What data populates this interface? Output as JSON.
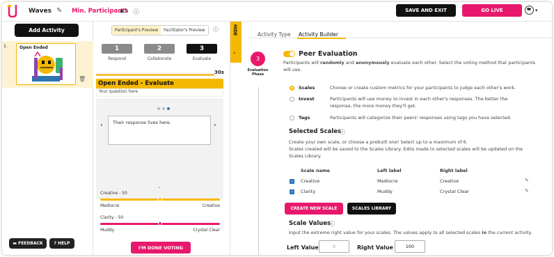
{
  "header": {
    "app_title": "Waves",
    "min_participants": "Min. Participants",
    "participant_count": "5",
    "save_exit": "SAVE AND EXIT",
    "go_live": "GO LIVE",
    "logo_color": "#e8196d"
  },
  "sidebar": {
    "add_activity": "Add Activity",
    "slide_number": "1.",
    "slide_title": "Open Ended",
    "feedback": "FEEDBACK",
    "help": "HELP"
  },
  "preview": {
    "tabs": [
      "Participant's Preview",
      "Facilitator's Preview"
    ],
    "active_tab": 0,
    "steps": [
      {
        "num": "1",
        "label": "Respond",
        "active": false
      },
      {
        "num": "2",
        "label": "Collaborate",
        "active": false
      },
      {
        "num": "3",
        "label": "Evaluate",
        "active": true
      }
    ],
    "timer": "30s",
    "question_title": "Open Ended - Evaluate",
    "question_sub": "Your question here",
    "response_text": "Their response lives here.",
    "scales": [
      {
        "name": "Creative",
        "value": "50",
        "left": "Mediocre",
        "right": "Creative",
        "color": "#f5b800"
      },
      {
        "name": "Clarity",
        "value": "50",
        "left": "Muddy",
        "right": "Crystal Clear",
        "color": "#e8196d"
      }
    ],
    "done_voting": "I'M DONE VOTING",
    "hide": "HIDE"
  },
  "builder": {
    "tabs": [
      "Activity Type",
      "Activity Builder"
    ],
    "active_tab": 1,
    "phase_number": "3",
    "phase_label": "Evaluation Phase",
    "peer_eval_title": "Peer Evaluation",
    "peer_eval_desc_1": "Participants will ",
    "peer_eval_desc_2": "randomly",
    "peer_eval_desc_3": " and ",
    "peer_eval_desc_4": "anonymously",
    "peer_eval_desc_5": " evaluate each other. Select the voting method that participants",
    "peer_eval_desc_6": "will use.",
    "methods": [
      {
        "name": "Scales",
        "desc": "Choose or create custom metrics for your participants to judge each other's work.",
        "desc2": "",
        "selected": true
      },
      {
        "name": "Invest",
        "desc": "Participants will use money to invest in each other's responses. The better the",
        "desc2": "response, the more money they'll get.",
        "selected": false
      },
      {
        "name": "Tags",
        "desc": "Participants will categorize their peers' responses using tags you have selected.",
        "desc2": "",
        "selected": false
      }
    ],
    "selected_scales_title": "Selected Scales",
    "selected_scales_desc1": "Create your own scale, or choose a prebuilt one! Select up to a maximum of 6.",
    "selected_scales_desc2": "Scales created will be saved to the Scales Library. Edits made to selected scales will be updated on the",
    "selected_scales_desc3": "Scales Library.",
    "table_headers": [
      "Scale name",
      "Left label",
      "Right label"
    ],
    "rows": [
      {
        "name": "Creative",
        "left": "Mediocre",
        "right": "Creative"
      },
      {
        "name": "Clarity",
        "left": "Muddy",
        "right": "Crystal Clear"
      }
    ],
    "create_scale": "CREATE NEW SCALE",
    "scales_library": "SCALES LIBRARY",
    "scale_values_title": "Scale Values",
    "scale_values_desc_1": "Input the extreme right value for your scales. The values apply to all selected scales ",
    "scale_values_desc_2": "in",
    "scale_values_desc_3": " the current activity.",
    "left_value_label": "Left Value",
    "left_value": "0",
    "right_value_label": "Right Value",
    "right_value": "100"
  }
}
